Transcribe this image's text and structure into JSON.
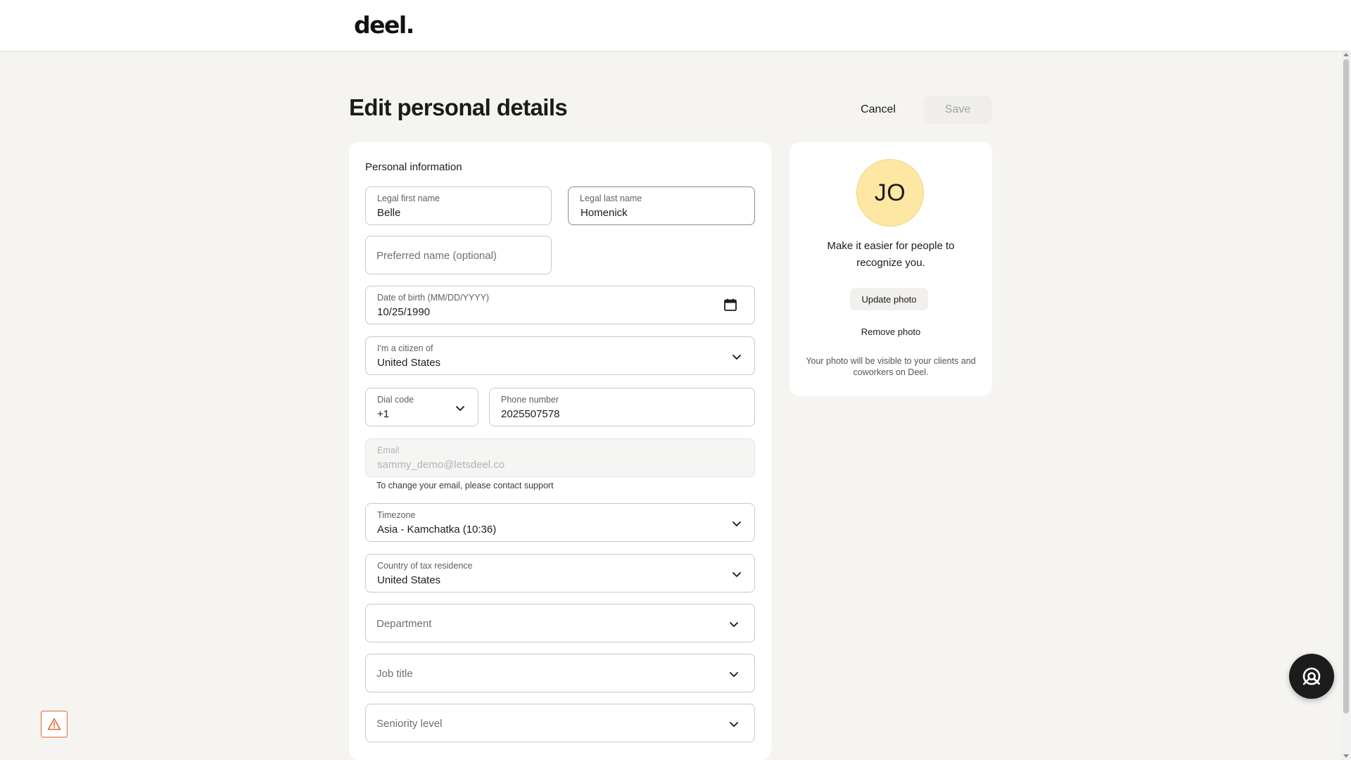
{
  "header": {
    "logo": "deel."
  },
  "page": {
    "title": "Edit personal details",
    "cancel_label": "Cancel",
    "save_label": "Save"
  },
  "form": {
    "section_title": "Personal information",
    "first_name": {
      "label": "Legal first name",
      "value": "Belle"
    },
    "last_name": {
      "label": "Legal last name",
      "value": "Homenick"
    },
    "preferred_name": {
      "placeholder": "Preferred name (optional)"
    },
    "dob": {
      "label": "Date of birth (MM/DD/YYYY)",
      "value": "10/25/1990",
      "icon": "calendar-icon"
    },
    "citizen": {
      "label": "I'm a citizen of",
      "value": "United States"
    },
    "dial_code": {
      "label": "Dial code",
      "value": "+1"
    },
    "phone": {
      "label": "Phone number",
      "value": "2025507578"
    },
    "email": {
      "label": "Email",
      "value": "sammy_demo@letsdeel.co",
      "helper": "To change your email, please contact support"
    },
    "timezone": {
      "label": "Timezone",
      "value": "Asia - Kamchatka (10:36)"
    },
    "tax_residence": {
      "label": "Country of tax residence",
      "value": "United States"
    },
    "department": {
      "placeholder": "Department"
    },
    "job_title": {
      "placeholder": "Job title"
    },
    "seniority": {
      "placeholder": "Seniority level"
    }
  },
  "photo": {
    "initials": "JO",
    "headline": "Make it easier for people to recognize you.",
    "update_label": "Update photo",
    "remove_label": "Remove photo",
    "note": "Your photo will be visible to your clients and coworkers on Deel."
  },
  "colors": {
    "background": "#f5f4f1",
    "avatar": "#fde7a3",
    "warning": "#e4652d",
    "fab": "#1c1c1c"
  },
  "icons": {
    "fab": "support-search-icon",
    "warning": "warning-triangle-icon",
    "dropdown": "chevron-down-icon"
  }
}
